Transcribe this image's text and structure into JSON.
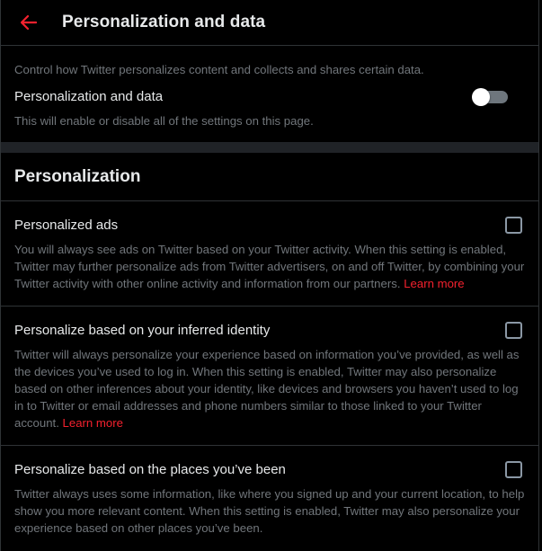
{
  "header": {
    "title": "Personalization and data",
    "back_icon": "arrow-left-icon",
    "accent_color": "#f4212e"
  },
  "intro": {
    "description": "Control how Twitter personalizes content and collects and shares certain data.",
    "master_setting": {
      "label": "Personalization and data",
      "description": "This will enable or disable all of the settings on this page.",
      "enabled": false
    }
  },
  "personalization": {
    "heading": "Personalization",
    "items": [
      {
        "label": "Personalized ads",
        "checked": false,
        "description": "You will always see ads on Twitter based on your Twitter activity. When this setting is enabled, Twitter may further personalize ads from Twitter advertisers, on and off Twitter, by combining your Twitter activity with other online activity and information from our partners.",
        "link": "Learn more"
      },
      {
        "label": "Personalize based on your inferred identity",
        "checked": false,
        "description": "Twitter will always personalize your experience based on information you’ve provided, as well as the devices you’ve used to log in. When this setting is enabled, Twitter may also personalize based on other inferences about your identity, like devices and browsers you haven’t used to log in to Twitter or email addresses and phone numbers similar to those linked to your Twitter account.",
        "link": "Learn more"
      },
      {
        "label": "Personalize based on the places you’ve been",
        "checked": false,
        "description": "Twitter always uses some information, like where you signed up and your current location, to help show you more relevant content. When this setting is enabled, Twitter may also personalize your experience based on other places you’ve been."
      }
    ]
  }
}
